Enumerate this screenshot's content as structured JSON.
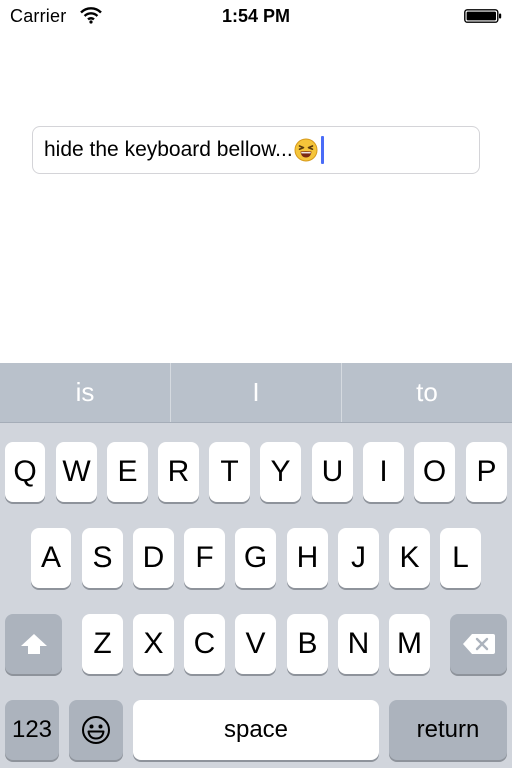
{
  "status_bar": {
    "carrier": "Carrier",
    "time": "1:54 PM",
    "wifi_icon": "wifi-icon",
    "battery_icon": "battery-icon"
  },
  "text_field": {
    "value": "hide the keyboard bellow...",
    "emoji_icon": "laughing-face-emoji",
    "caret_color": "#4a6cf7"
  },
  "keyboard": {
    "suggestions": [
      "is",
      "I",
      "to"
    ],
    "row1": [
      "Q",
      "W",
      "E",
      "R",
      "T",
      "Y",
      "U",
      "I",
      "O",
      "P"
    ],
    "row2": [
      "A",
      "S",
      "D",
      "F",
      "G",
      "H",
      "J",
      "K",
      "L"
    ],
    "row3": [
      "Z",
      "X",
      "C",
      "V",
      "B",
      "N",
      "M"
    ],
    "shift_icon": "shift-icon",
    "delete_icon": "delete-icon",
    "numbers_label": "123",
    "emoji_key_icon": "emoji-keyboard-icon",
    "space_label": "space",
    "return_label": "return"
  }
}
